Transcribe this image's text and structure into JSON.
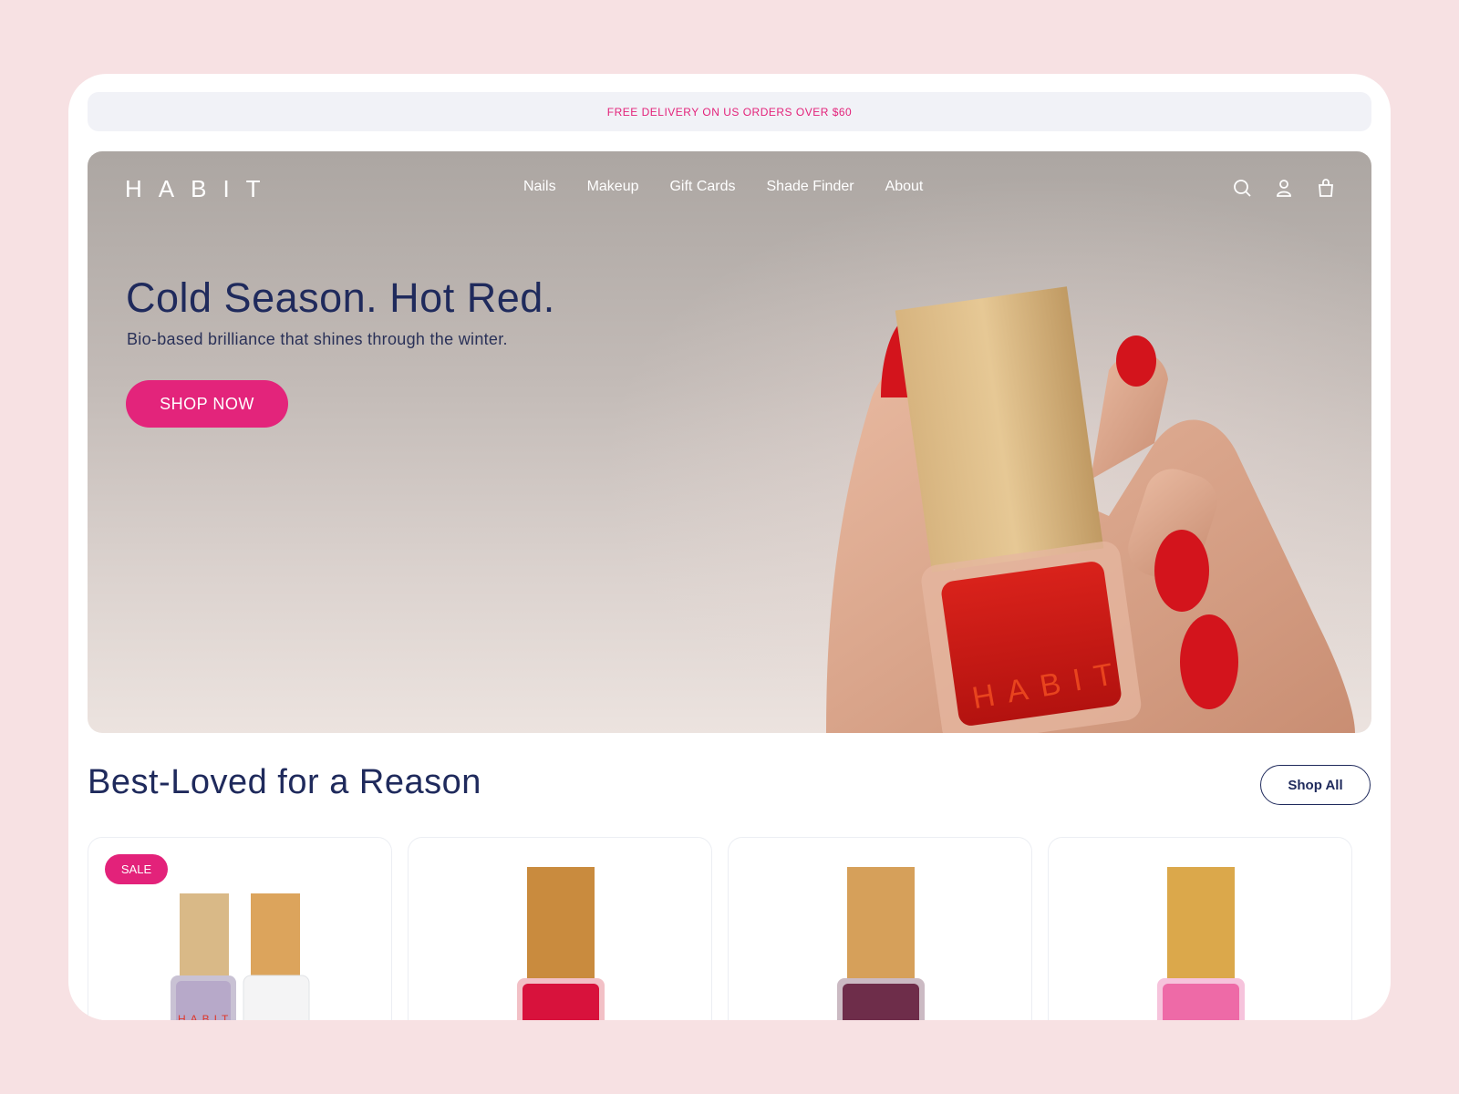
{
  "announcement": "FREE DELIVERY ON US ORDERS OVER $60",
  "header": {
    "logo": "HABIT",
    "nav": [
      "Nails",
      "Makeup",
      "Gift Cards",
      "Shade Finder",
      "About"
    ],
    "icons": [
      "search-icon",
      "account-icon",
      "bag-icon"
    ]
  },
  "hero": {
    "title": "Cold Season. Hot Red.",
    "subtitle": "Bio-based brilliance that shines through the winter.",
    "cta": "SHOP NOW",
    "bottle_label": "HABIT"
  },
  "best_loved": {
    "title": "Best-Loved for a Reason",
    "shop_all": "Shop All",
    "products": [
      {
        "badge": "SALE",
        "colors": [
          "#b7a9c9",
          "#eef0f2"
        ],
        "label": "HABIT"
      },
      {
        "badge": "",
        "colors": [
          "#d8123c"
        ],
        "label": ""
      },
      {
        "badge": "",
        "colors": [
          "#6e2d4a"
        ],
        "label": ""
      },
      {
        "badge": "",
        "colors": [
          "#ee6aa7"
        ],
        "label": ""
      }
    ]
  },
  "colors": {
    "accent": "#e3247b",
    "navy": "#1f2a5c",
    "background": "#f7e1e3"
  }
}
